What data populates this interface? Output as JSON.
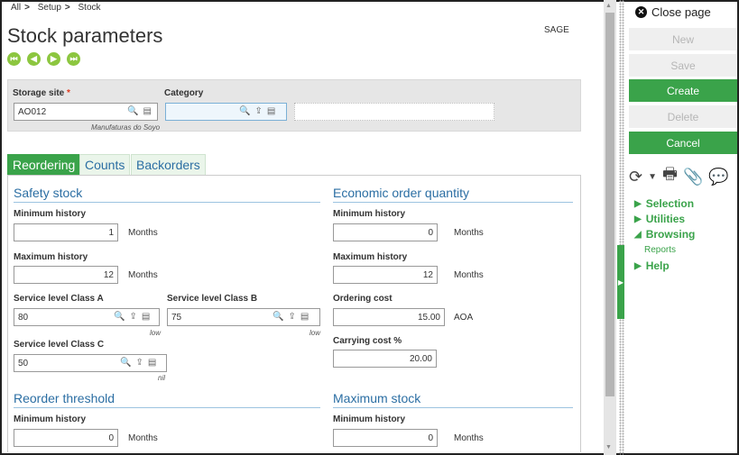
{
  "breadcrumb": [
    "All",
    "Setup",
    "Stock"
  ],
  "page_title": "Stock parameters",
  "folder": "SAGE",
  "header": {
    "storage_site_label": "Storage site",
    "storage_site_required": "*",
    "storage_site_value": "AO012",
    "storage_site_desc": "Manufaturas do Soyo",
    "category_label": "Category",
    "category_value": "",
    "category_desc": ""
  },
  "tabs": [
    "Reordering",
    "Counts",
    "Backorders"
  ],
  "safety_stock": {
    "title": "Safety stock",
    "min_label": "Minimum history",
    "min_value": "1",
    "min_unit": "Months",
    "max_label": "Maximum history",
    "max_value": "12",
    "max_unit": "Months",
    "class_a_label": "Service level Class A",
    "class_a_value": "80",
    "class_a_note": "low",
    "class_b_label": "Service level Class B",
    "class_b_value": "75",
    "class_b_note": "low",
    "class_c_label": "Service level Class C",
    "class_c_value": "50",
    "class_c_note": "nil"
  },
  "eoq": {
    "title": "Economic order quantity",
    "min_label": "Minimum history",
    "min_value": "0",
    "min_unit": "Months",
    "max_label": "Maximum history",
    "max_value": "12",
    "max_unit": "Months",
    "ordering_cost_label": "Ordering cost",
    "ordering_cost_value": "15.00",
    "ordering_cost_unit": "AOA",
    "carrying_cost_label": "Carrying cost %",
    "carrying_cost_value": "20.00"
  },
  "reorder_threshold": {
    "title": "Reorder threshold",
    "min_label": "Minimum history",
    "min_value": "0",
    "min_unit": "Months"
  },
  "maximum_stock": {
    "title": "Maximum stock",
    "min_label": "Minimum history",
    "min_value": "0",
    "min_unit": "Months"
  },
  "right_panel": {
    "close_label": "Close page",
    "new_label": "New",
    "save_label": "Save",
    "create_label": "Create",
    "delete_label": "Delete",
    "cancel_label": "Cancel",
    "menu_selection": "Selection",
    "menu_utilities": "Utilities",
    "menu_browsing": "Browsing",
    "menu_reports": "Reports",
    "menu_help": "Help"
  },
  "colors": {
    "accent_green": "#3aa34a",
    "link_blue": "#2b6ea3",
    "required_red": "#e03a1e"
  }
}
